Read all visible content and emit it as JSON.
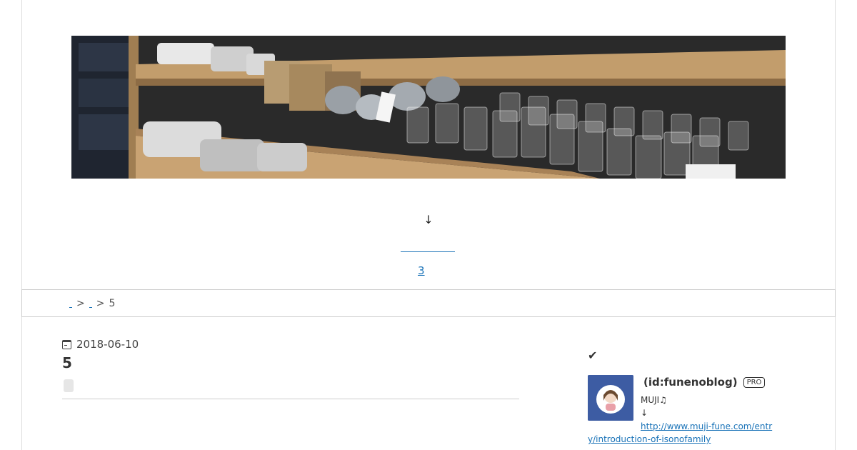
{
  "hero": {
    "image_description_icon": "store-shelf-image"
  },
  "content": {
    "arrow": "↓",
    "count_link": "3"
  },
  "breadcrumb": {
    "separator": ">",
    "current": "5"
  },
  "article": {
    "date": "2018-06-10",
    "title": "5"
  },
  "sidebar": {
    "check_icon": "✔",
    "author_name": "(id:funenoblog)",
    "badge": "PRO",
    "profile_line1": "MUJI♫",
    "profile_line2": "↓",
    "profile_url": "http://www.muji-fune.com/entry/introduction-of-isonofamily"
  },
  "colors": {
    "link": "#1a73b8",
    "avatar_bg": "#3d5ca3",
    "shelf_wood": "#b8956a"
  }
}
